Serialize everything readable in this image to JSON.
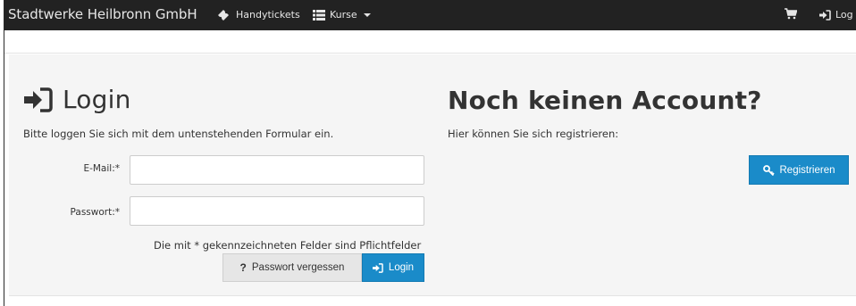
{
  "navbar": {
    "brand": "Stadtwerke Heilbronn GmbH",
    "handytickets_label": "Handytickets",
    "kurse_label": "Kurse",
    "login_label": "Log"
  },
  "login": {
    "title": "Login",
    "intro": "Bitte loggen Sie sich mit dem untenstehenden Formular ein.",
    "email_label": "E-Mail:*",
    "email_value": "",
    "password_label": "Passwort:*",
    "password_value": "",
    "required_note": "Die mit * gekennzeichneten Felder sind Pflichtfelder",
    "forgot_button": "Passwort vergessen",
    "forgot_icon_glyph": "?",
    "login_button": "Login"
  },
  "register": {
    "title": "Noch keinen Account?",
    "intro": "Hier können Sie sich registrieren:",
    "register_button": "Registrieren"
  },
  "colors": {
    "navbar_bg": "#222222",
    "primary": "#1a8bc9",
    "panel_bg": "#f5f5f5"
  },
  "icons": {
    "handytickets": "ticket-icon",
    "kurse": "list-icon",
    "cart": "shopping-cart-icon",
    "login": "sign-in-icon",
    "register": "key-icon",
    "forgot": "question-icon"
  }
}
